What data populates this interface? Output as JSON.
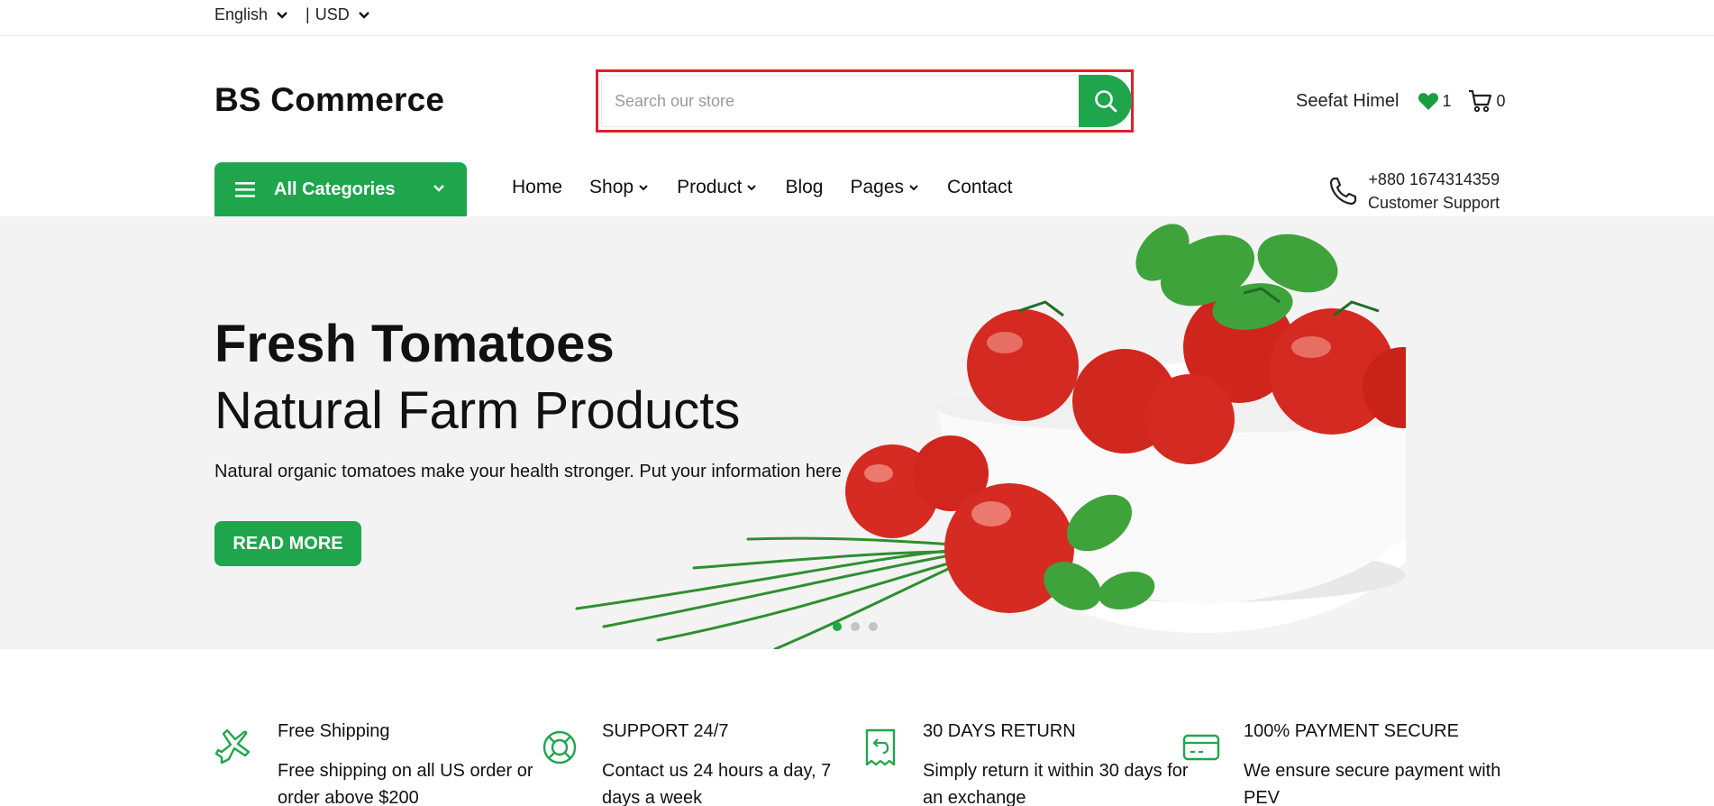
{
  "topbar": {
    "language": "English",
    "separator": "|",
    "currency": "USD"
  },
  "header": {
    "logo": "BS Commerce",
    "search": {
      "placeholder": "Search our store",
      "value": ""
    },
    "user_name": "Seefat Himel",
    "wishlist_count": "1",
    "cart_count": "0"
  },
  "nav": {
    "all_categories": "All Categories",
    "items": [
      {
        "label": "Home",
        "dropdown": false
      },
      {
        "label": "Shop",
        "dropdown": true
      },
      {
        "label": "Product",
        "dropdown": true
      },
      {
        "label": "Blog",
        "dropdown": false
      },
      {
        "label": "Pages",
        "dropdown": true
      },
      {
        "label": "Contact",
        "dropdown": false
      }
    ],
    "phone": "+880 1674314359",
    "support_label": "Customer Support"
  },
  "hero": {
    "title": "Fresh Tomatoes",
    "subtitle": "Natural Farm Products",
    "description": "Natural organic tomatoes make your health stronger. Put your information here",
    "button": "READ MORE",
    "slides": 3,
    "active_slide": 1
  },
  "features": [
    {
      "icon": "airplane-icon",
      "title": "Free Shipping",
      "desc": "Free shipping on all US order or order above $200"
    },
    {
      "icon": "lifebuoy-icon",
      "title": "SUPPORT 24/7",
      "desc": "Contact us 24 hours a day, 7 days a week"
    },
    {
      "icon": "return-receipt-icon",
      "title": "30 DAYS RETURN",
      "desc": "Simply return it within 30 days for an exchange"
    },
    {
      "icon": "credit-card-icon",
      "title": "100% PAYMENT SECURE",
      "desc": "We ensure secure payment with PEV"
    }
  ],
  "colors": {
    "brand_green": "#1fa64d",
    "highlight_red": "#e0202c",
    "hero_bg": "#f3f3f3"
  }
}
